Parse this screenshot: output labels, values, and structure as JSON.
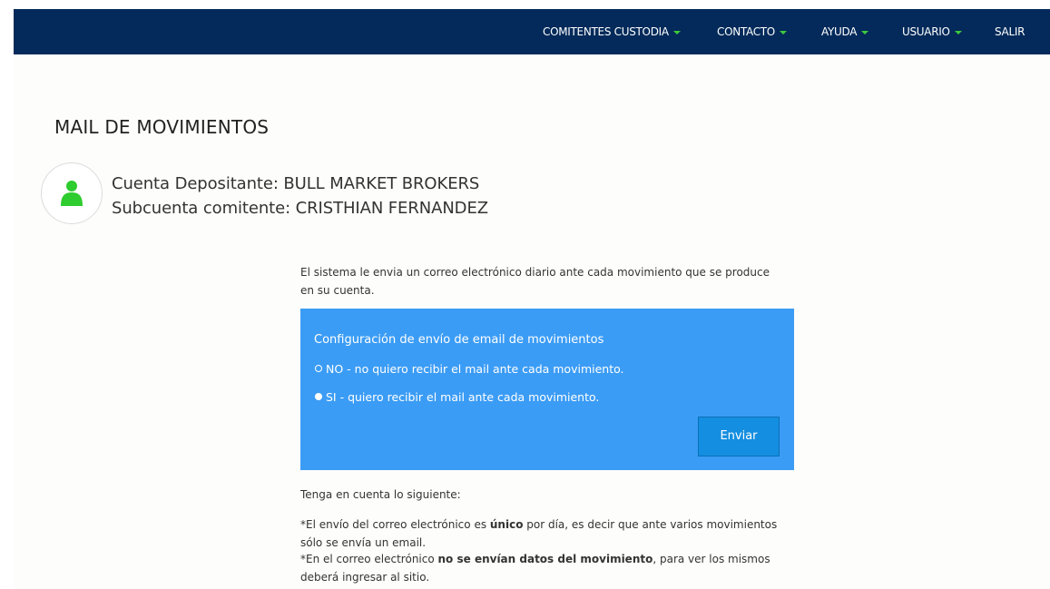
{
  "nav": {
    "items": [
      {
        "label": "COMITENTES CUSTODIA",
        "has_caret": true
      },
      {
        "label": "CONTACTO",
        "has_caret": true
      },
      {
        "label": "AYUDA",
        "has_caret": true
      },
      {
        "label": "USUARIO",
        "has_caret": true
      },
      {
        "label": "SALIR",
        "has_caret": false
      }
    ]
  },
  "page": {
    "title": "MAIL DE MOVIMIENTOS",
    "account": {
      "icon": "user-icon",
      "depositante": "Cuenta Depositante: BULL MARKET BROKERS",
      "subcuenta": "Subcuenta comitente: CRISTHIAN FERNANDEZ"
    },
    "intro": "El sistema le envia un correo electrónico diario ante cada movimiento que se produce en su cuenta."
  },
  "panel": {
    "title": "Configuración de envío de email de movimientos",
    "options": [
      {
        "label": "NO - no quiero recibir el mail ante cada movimiento.",
        "selected": false
      },
      {
        "label": "SI - quiero recibir el mail ante cada movimiento.",
        "selected": true
      }
    ],
    "submit_label": "Enviar"
  },
  "notes": {
    "heading": "Tenga en cuenta lo siguiente:",
    "note1_before": "*El envío del correo electrónico es ",
    "note1_bold": "único",
    "note1_after": " por día, es decir que ante varios movimientos sólo se envía un email.",
    "note2_before": "*En el correo electrónico ",
    "note2_bold": "no se envían datos del movimiento",
    "note2_after": ", para ver los mismos deberá ingresar al sitio."
  },
  "colors": {
    "navbar": "#032a5a",
    "caret": "#3ec93e",
    "panel": "#3b9cf5",
    "button": "#148ee0",
    "avatar_icon": "#2ecc2e"
  }
}
